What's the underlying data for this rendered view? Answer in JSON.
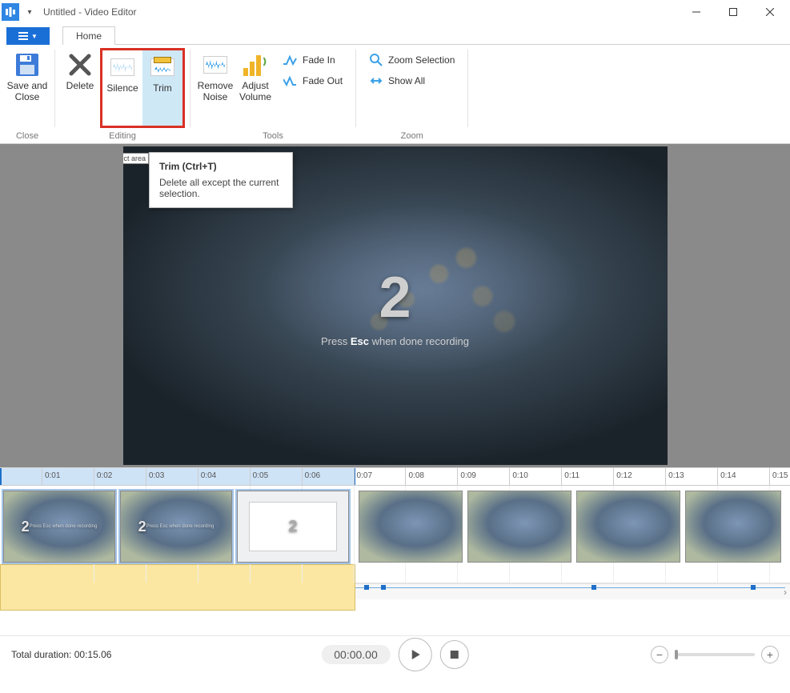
{
  "window": {
    "title": "Untitled - Video Editor"
  },
  "tabs": {
    "home": "Home"
  },
  "ribbon": {
    "groups": {
      "close": {
        "name": "Close",
        "saveclose": "Save and\nClose"
      },
      "editing": {
        "name": "Editing",
        "delete": "Delete",
        "silence": "Silence",
        "trim": "Trim"
      },
      "tools": {
        "name": "Tools",
        "remove_noise": "Remove\nNoise",
        "adjust_volume": "Adjust\nVolume",
        "fadein": "Fade In",
        "fadeout": "Fade Out"
      },
      "zoom": {
        "name": "Zoom",
        "zoom_selection": "Zoom Selection",
        "show_all": "Show All"
      }
    }
  },
  "tooltip": {
    "title": "Trim (Ctrl+T)",
    "body": "Delete all except the current selection."
  },
  "preview": {
    "badge": "lect area",
    "countdown": "2",
    "hint_prefix": "Press ",
    "hint_key": "Esc",
    "hint_suffix": " when done recording"
  },
  "timeline": {
    "ticks": [
      "0:01",
      "0:02",
      "0:03",
      "0:04",
      "0:05",
      "0:06",
      "0:07",
      "0:08",
      "0:09",
      "0:10",
      "0:11",
      "0:12",
      "0:13",
      "0:14",
      "0:15"
    ],
    "selection_end_tick_index": 6
  },
  "footer": {
    "duration_label": "Total duration: ",
    "duration_value": "00:15.06",
    "play_time": "00:00.00"
  }
}
